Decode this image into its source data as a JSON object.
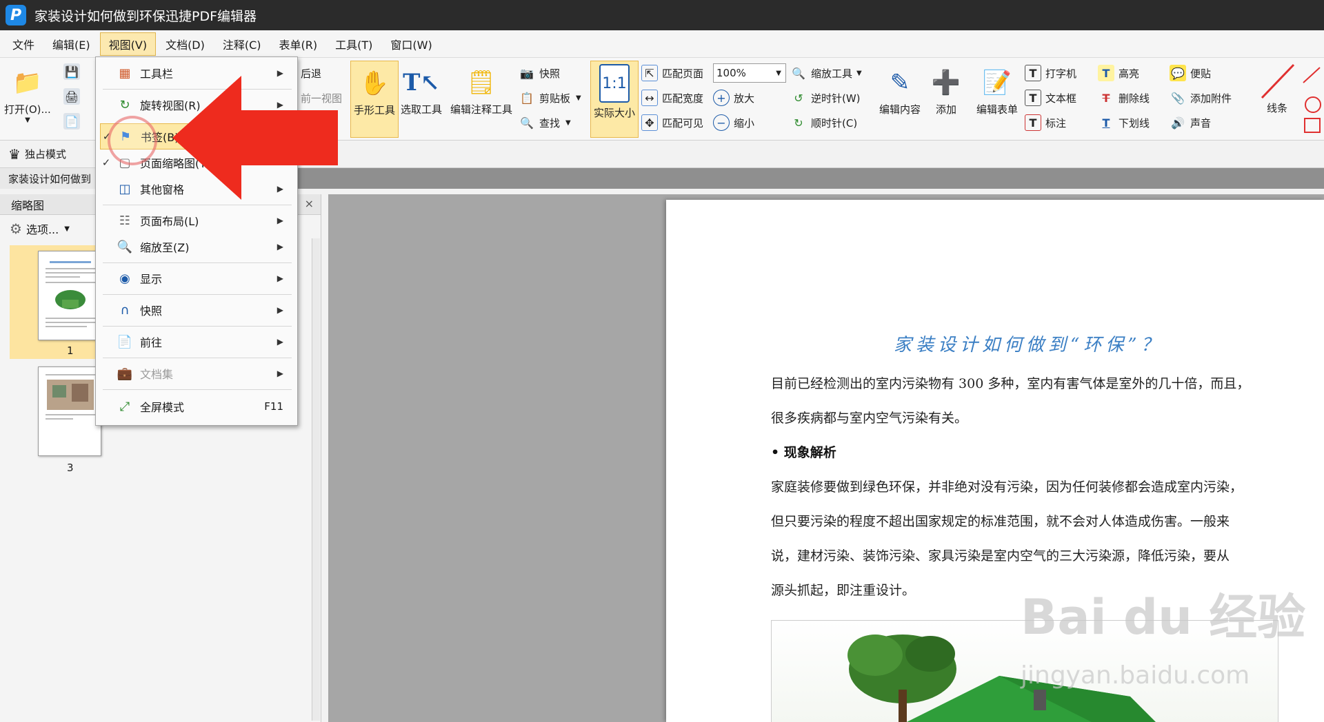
{
  "window": {
    "title": "家装设计如何做到环保迅捷PDF编辑器"
  },
  "menubar": [
    {
      "label": "文件"
    },
    {
      "label": "编辑(E)"
    },
    {
      "label": "视图(V)",
      "active": true
    },
    {
      "label": "文档(D)"
    },
    {
      "label": "注释(C)"
    },
    {
      "label": "表单(R)"
    },
    {
      "label": "工具(T)"
    },
    {
      "label": "窗口(W)"
    }
  ],
  "ribbon": {
    "open": "打开(O)...",
    "back": "后退",
    "prev_view": "前一视图",
    "hand_tool": "手形工具",
    "select_tool": "选取工具",
    "edit_annot_tool": "编辑注释工具",
    "snapshot": "快照",
    "clipboard": "剪贴板",
    "find": "查找",
    "actual_size": "实际大小",
    "actual_size_icon": "1:1",
    "fit_page": "匹配页面",
    "fit_width": "匹配宽度",
    "fit_visible": "匹配可见",
    "zoom_value": "100%",
    "zoom_tool": "缩放工具",
    "zoom_in": "放大",
    "zoom_out": "缩小",
    "rotate_ccw": "逆时针(W)",
    "rotate_cw": "顺时针(C)",
    "edit_content": "编辑内容",
    "add": "添加",
    "edit_form": "编辑表单",
    "typewriter": "打字机",
    "textbox": "文本框",
    "callout": "标注",
    "highlight": "高亮",
    "strikeout": "删除线",
    "underline": "下划线",
    "sticky": "便贴",
    "attach": "添加附件",
    "sound": "声音",
    "line": "线条"
  },
  "subbar": {
    "exclusive_mode": "独占模式"
  },
  "doc_tab": "家装设计如何做到",
  "left_panel": {
    "title": "缩略图",
    "options": "选项...",
    "pages": [
      {
        "label": "1"
      },
      {
        "label": "3"
      }
    ]
  },
  "view_menu": [
    {
      "label": "工具栏",
      "icon": "toolbar-icon",
      "submenu": true
    },
    {
      "label": "旋转视图(R)",
      "icon": "rotate-icon",
      "submenu": true
    },
    {
      "label": "书签(B)",
      "icon": "bookmark-icon",
      "checked": true,
      "hover": true
    },
    {
      "label": "页面缩略图(T)",
      "icon": "thumbnail-icon",
      "checked": true
    },
    {
      "label": "其他窗格",
      "icon": "panes-icon",
      "submenu": true
    },
    {
      "label": "页面布局(L)",
      "icon": "layout-icon",
      "submenu": true
    },
    {
      "label": "缩放至(Z)",
      "icon": "zoom-icon",
      "submenu": true
    },
    {
      "label": "显示",
      "icon": "eye-icon",
      "submenu": true
    },
    {
      "label": "快照",
      "icon": "snapshot-icon",
      "submenu": true
    },
    {
      "label": "前往",
      "icon": "goto-icon",
      "submenu": true
    },
    {
      "label": "文档集",
      "icon": "portfolio-icon",
      "submenu": true,
      "disabled": true
    },
    {
      "label": "全屏模式",
      "icon": "fullscreen-icon",
      "shortcut": "F11"
    }
  ],
  "document": {
    "title": "家装设计如何做到“环保”？",
    "p1_line1": "目前已经检测出的室内污染物有 300 多种，室内有害气体是室外的几十倍，而且，",
    "p1_line2": "很多疾病都与室内空气污染有关。",
    "heading": "• 现象解析",
    "p2_line1": "家庭装修要做到绿色环保，并非绝对没有污染，因为任何装修都会造成室内污染，",
    "p2_line2": "但只要污染的程度不超出国家规定的标准范围，就不会对人体造成伤害。一般来",
    "p2_line3": "说，建材污染、装饰污染、家具污染是室内空气的三大污染源，降低污染，要从",
    "p2_line4": "源头抓起，即注重设计。"
  },
  "watermark": {
    "main": "Bai du 经验",
    "sub": "jingyan.baidu.com"
  },
  "colors": {
    "accent": "#fde9a6",
    "title_blue": "#3b7fc4",
    "arrow_red": "#ee2b1e"
  }
}
